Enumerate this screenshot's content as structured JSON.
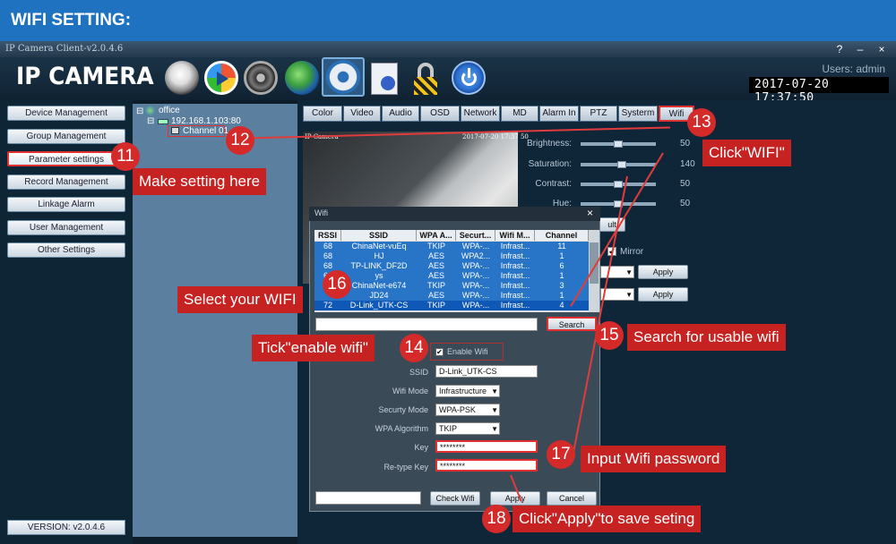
{
  "banner": {
    "title": "WIFI SETTING:"
  },
  "window": {
    "title": "IP Camera Client-v2.0.4.6",
    "buttons": [
      "?",
      "–",
      "×"
    ],
    "logo": "IP CAMERA",
    "users_label": "Users: admin",
    "clock": "2017-07-20  17:37:50",
    "toolbar_icons": [
      "webcam-icon",
      "playback-icon",
      "ptz-wheel-icon",
      "globe-icon",
      "settings-gear-icon",
      "log-document-icon",
      "lock-icon",
      "power-icon"
    ]
  },
  "sidebar": {
    "items": [
      {
        "label": "Device Management"
      },
      {
        "label": "Group Management"
      },
      {
        "label": "Parameter settings"
      },
      {
        "label": "Record Management"
      },
      {
        "label": "Linkage Alarm"
      },
      {
        "label": "User Management"
      },
      {
        "label": "Other Settings"
      }
    ],
    "version": "VERSION: v2.0.4.6"
  },
  "tree": {
    "root": "office",
    "device": "192.168.1.103:80",
    "channel": "Channel 01"
  },
  "tabs": [
    "Color",
    "Video",
    "Audio",
    "OSD",
    "Network",
    "MD",
    "Alarm In",
    "PTZ",
    "Systerm",
    "Wifi"
  ],
  "preview": {
    "label": "IP Camera",
    "timestamp": "2017-07-20 17:37 50"
  },
  "color_settings": {
    "items": [
      {
        "label": "Brightness:",
        "value": "50",
        "level": 0.5
      },
      {
        "label": "Saturation:",
        "value": "140",
        "level": 0.55
      },
      {
        "label": "Contrast:",
        "value": "50",
        "level": 0.5
      },
      {
        "label": "Hue:",
        "value": "50",
        "level": 0.5
      }
    ],
    "default_button": "ult",
    "mirror_label": "Mirror",
    "apply_label": "Apply"
  },
  "wifi_dialog": {
    "title": "Wifi",
    "close": "×",
    "columns": [
      "RSSI",
      "SSID",
      "WPA A...",
      "Securt...",
      "Wifi M...",
      "Channel"
    ],
    "rows": [
      [
        "68",
        "ChinaNet-vuEq",
        "TKIP",
        "WPA-...",
        "Infrast...",
        "11"
      ],
      [
        "68",
        "HJ",
        "AES",
        "WPA2...",
        "Infrast...",
        "1"
      ],
      [
        "68",
        "TP-LINK_DF2D",
        "AES",
        "WPA-...",
        "Infrast...",
        "6"
      ],
      [
        "68",
        "ys",
        "AES",
        "WPA-...",
        "Infrast...",
        "1"
      ],
      [
        "68",
        "ChinaNet-e674",
        "TKIP",
        "WPA-...",
        "Infrast...",
        "3"
      ],
      [
        "",
        "JD24",
        "AES",
        "WPA-...",
        "Infrast...",
        "1"
      ],
      [
        "72",
        "D-Link_UTK-CS",
        "TKIP",
        "WPA-...",
        "Infrast...",
        "4"
      ]
    ],
    "search_button": "Search",
    "enable_label": "Enable Wifi",
    "fields": {
      "ssid_label": "SSID",
      "ssid_value": "D-Link_UTK-CS",
      "mode_label": "Wifi Mode",
      "mode_value": "Infrastructure",
      "security_label": "Securty Mode",
      "security_value": "WPA-PSK",
      "algorithm_label": "WPA Algorithm",
      "algorithm_value": "TKIP",
      "key_label": "Key",
      "key_value": "********",
      "retype_label": "Re-type Key",
      "retype_value": "********"
    },
    "check_button": "Check Wifi",
    "apply_button": "Apply",
    "cancel_button": "Cancel"
  },
  "annotations": [
    {
      "num": "11",
      "text": "Make setting here"
    },
    {
      "num": "12",
      "text": ""
    },
    {
      "num": "13",
      "text": "Click\"WIFI\""
    },
    {
      "num": "14",
      "text": "Tick\"enable wifi\""
    },
    {
      "num": "15",
      "text": "Search for usable wifi"
    },
    {
      "num": "16",
      "text": "Select your WIFI"
    },
    {
      "num": "17",
      "text": "Input Wifi password"
    },
    {
      "num": "18",
      "text": "Click\"Apply\"to save seting"
    }
  ],
  "colors": {
    "banner": "#1e72c0",
    "annotation": "#c62222",
    "accent": "#2874c7"
  }
}
